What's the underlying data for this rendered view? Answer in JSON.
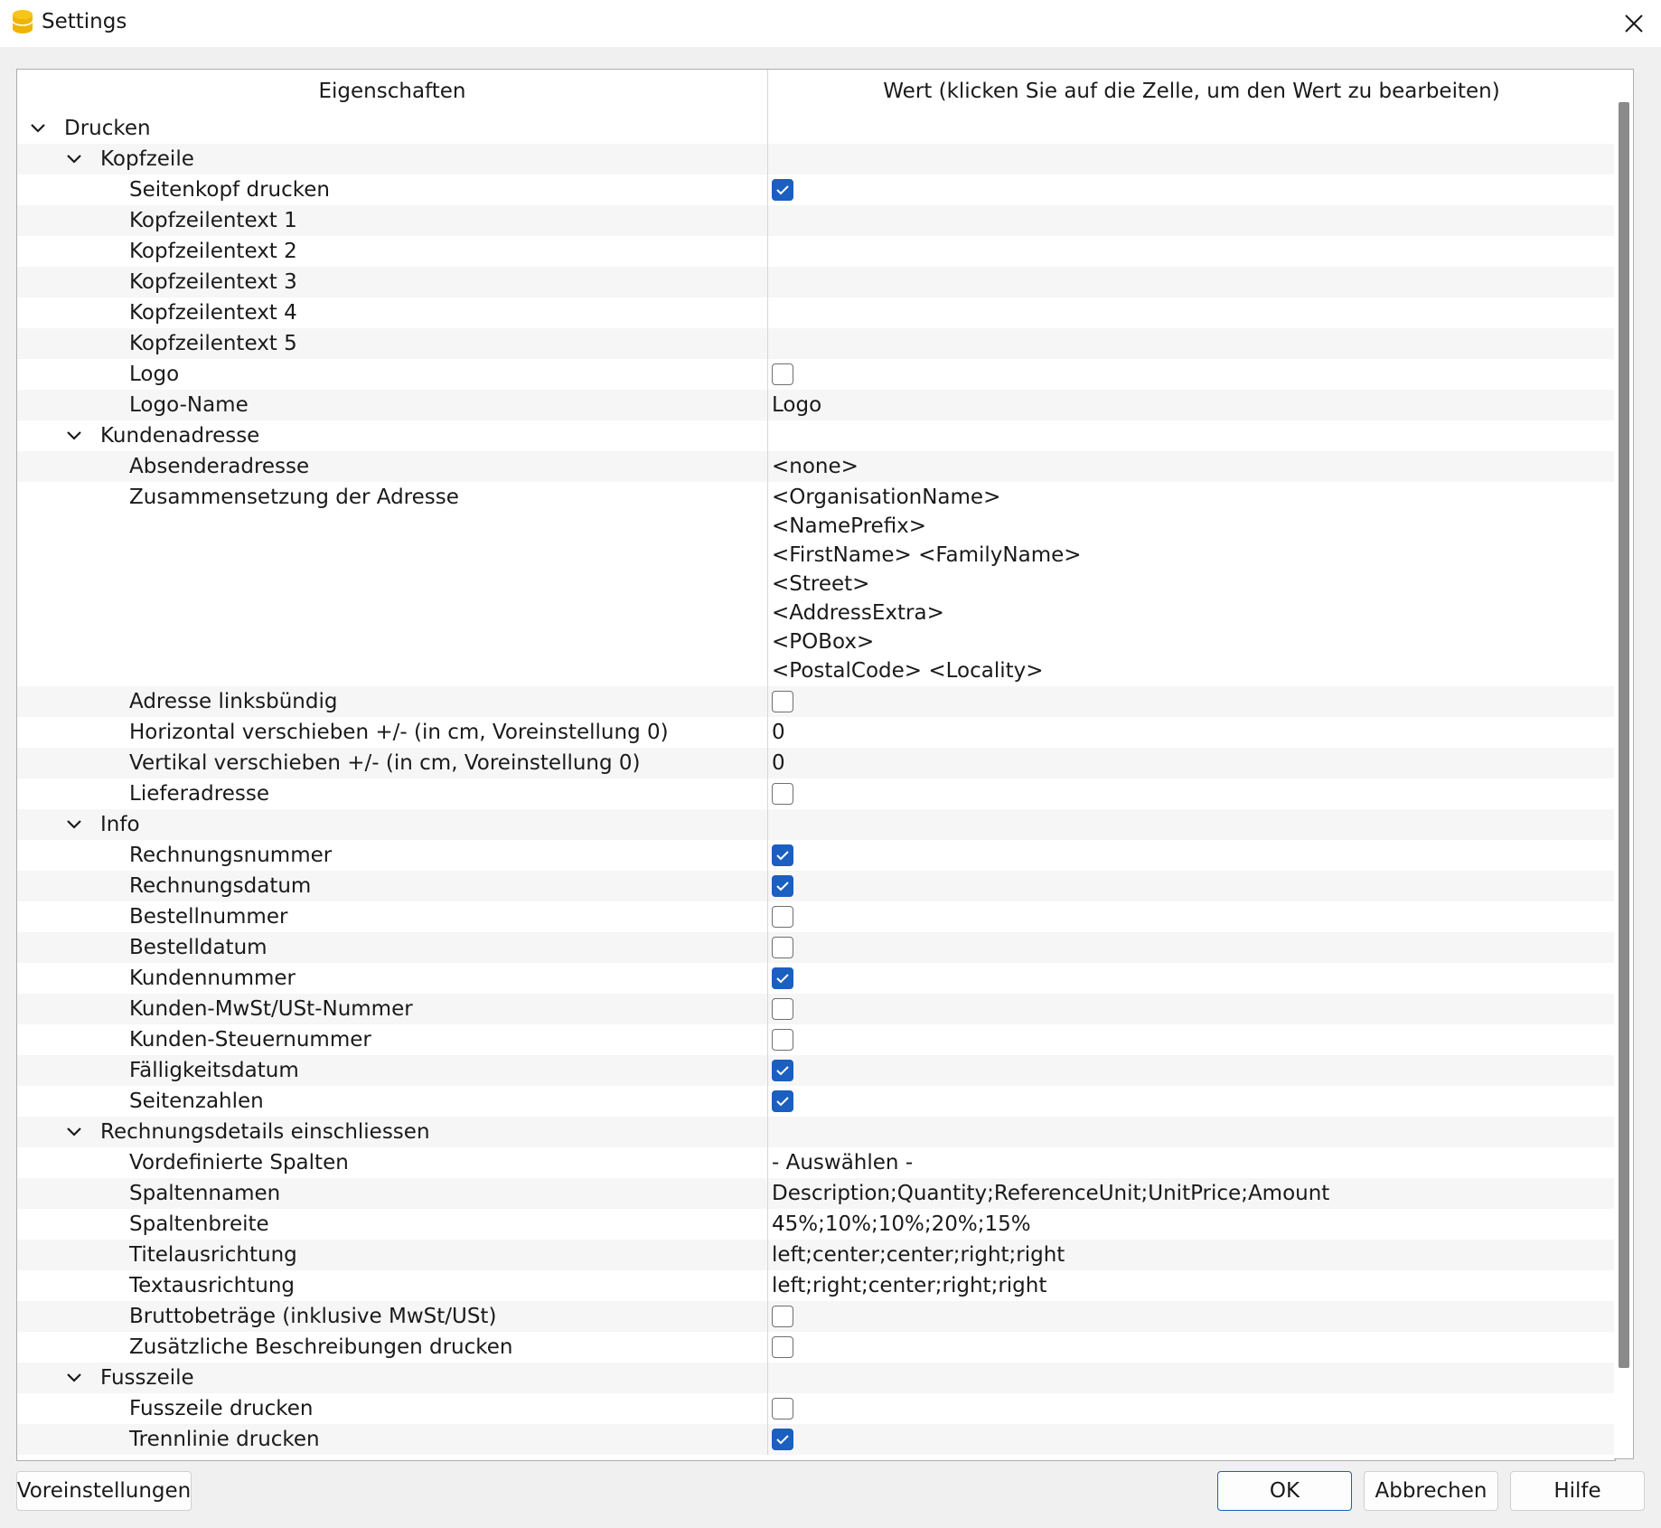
{
  "window": {
    "title": "Settings",
    "app_icon": "app-icon",
    "close_icon": "close-icon"
  },
  "table": {
    "col_property": "Eigenschaften",
    "col_value": "Wert (klicken Sie auf die Zelle, um den Wert zu bearbeiten)",
    "rows": [
      {
        "level": 0,
        "group": true,
        "label": "Drucken"
      },
      {
        "level": 1,
        "group": true,
        "label": "Kopfzeile"
      },
      {
        "level": 2,
        "label": "Seitenkopf drucken",
        "checkbox": true,
        "checked": true
      },
      {
        "level": 2,
        "label": "Kopfzeilentext 1",
        "value": ""
      },
      {
        "level": 2,
        "label": "Kopfzeilentext 2",
        "value": ""
      },
      {
        "level": 2,
        "label": "Kopfzeilentext 3",
        "value": ""
      },
      {
        "level": 2,
        "label": "Kopfzeilentext 4",
        "value": ""
      },
      {
        "level": 2,
        "label": "Kopfzeilentext 5",
        "value": ""
      },
      {
        "level": 2,
        "label": "Logo",
        "checkbox": true,
        "checked": false
      },
      {
        "level": 2,
        "label": "Logo-Name",
        "value": "Logo"
      },
      {
        "level": 1,
        "group": true,
        "label": "Kundenadresse"
      },
      {
        "level": 2,
        "label": "Absenderadresse",
        "value": "<none>"
      },
      {
        "level": 2,
        "label": "Zusammensetzung der Adresse",
        "lines": [
          "<OrganisationName>",
          "<NamePrefix>",
          "<FirstName> <FamilyName>",
          "<Street>",
          "<AddressExtra>",
          "<POBox>",
          "<PostalCode> <Locality>"
        ]
      },
      {
        "level": 2,
        "label": "Adresse linksbündig",
        "checkbox": true,
        "checked": false
      },
      {
        "level": 2,
        "label": "Horizontal verschieben +/- (in cm, Voreinstellung 0)",
        "value": "0"
      },
      {
        "level": 2,
        "label": "Vertikal verschieben +/- (in cm, Voreinstellung 0)",
        "value": "0"
      },
      {
        "level": 2,
        "label": "Lieferadresse",
        "checkbox": true,
        "checked": false
      },
      {
        "level": 1,
        "group": true,
        "label": "Info"
      },
      {
        "level": 2,
        "label": "Rechnungsnummer",
        "checkbox": true,
        "checked": true
      },
      {
        "level": 2,
        "label": "Rechnungsdatum",
        "checkbox": true,
        "checked": true
      },
      {
        "level": 2,
        "label": "Bestellnummer",
        "checkbox": true,
        "checked": false
      },
      {
        "level": 2,
        "label": "Bestelldatum",
        "checkbox": true,
        "checked": false
      },
      {
        "level": 2,
        "label": "Kundennummer",
        "checkbox": true,
        "checked": true
      },
      {
        "level": 2,
        "label": "Kunden-MwSt/USt-Nummer",
        "checkbox": true,
        "checked": false
      },
      {
        "level": 2,
        "label": "Kunden-Steuernummer",
        "checkbox": true,
        "checked": false
      },
      {
        "level": 2,
        "label": "Fälligkeitsdatum",
        "checkbox": true,
        "checked": true
      },
      {
        "level": 2,
        "label": "Seitenzahlen",
        "checkbox": true,
        "checked": true
      },
      {
        "level": 1,
        "group": true,
        "label": "Rechnungsdetails einschliessen"
      },
      {
        "level": 2,
        "label": "Vordefinierte Spalten",
        "value": "- Auswählen -"
      },
      {
        "level": 2,
        "label": "Spaltennamen",
        "value": "Description;Quantity;ReferenceUnit;UnitPrice;Amount"
      },
      {
        "level": 2,
        "label": "Spaltenbreite",
        "value": "45%;10%;10%;20%;15%"
      },
      {
        "level": 2,
        "label": "Titelausrichtung",
        "value": "left;center;center;right;right"
      },
      {
        "level": 2,
        "label": "Textausrichtung",
        "value": "left;right;center;right;right"
      },
      {
        "level": 2,
        "label": "Bruttobeträge (inklusive MwSt/USt)",
        "checkbox": true,
        "checked": false
      },
      {
        "level": 2,
        "label": "Zusätzliche Beschreibungen drucken",
        "checkbox": true,
        "checked": false
      },
      {
        "level": 1,
        "group": true,
        "label": "Fusszeile"
      },
      {
        "level": 2,
        "label": "Fusszeile drucken",
        "checkbox": true,
        "checked": false
      },
      {
        "level": 2,
        "label": "Trennlinie drucken",
        "checkbox": true,
        "checked": true
      }
    ]
  },
  "buttons": {
    "defaults": "Voreinstellungen",
    "ok": "OK",
    "cancel": "Abbrechen",
    "help": "Hilfe"
  },
  "colors": {
    "accent": "#1b5fc0",
    "app_icon": "#f5c518"
  }
}
